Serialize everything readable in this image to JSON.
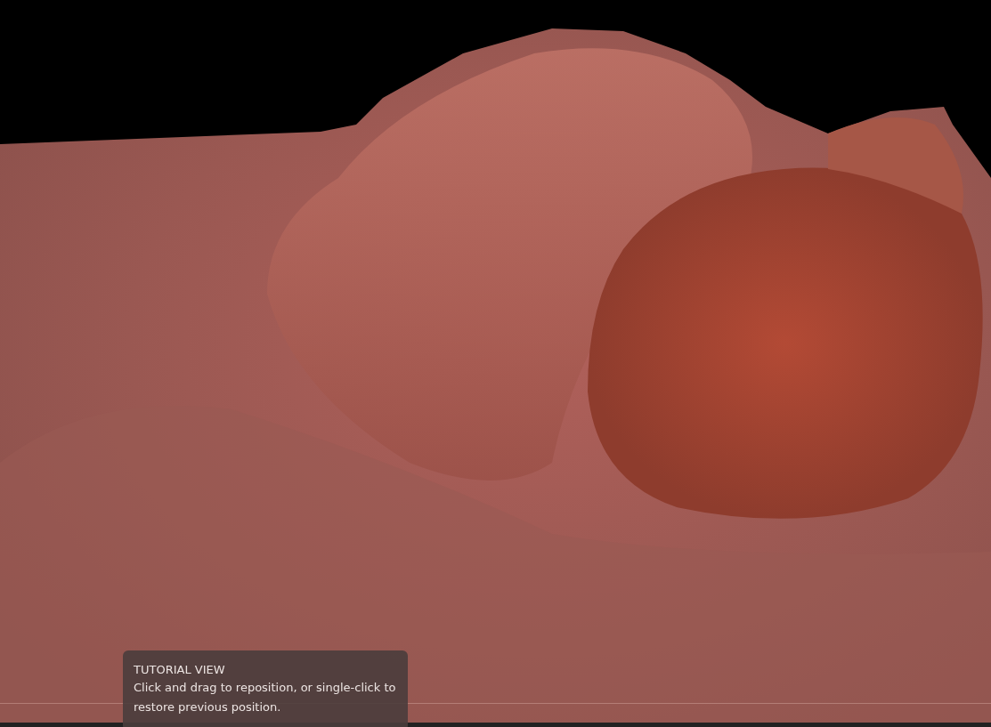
{
  "tooltip": {
    "title": "TUTORIAL VIEW",
    "message": "Click and drag to reposition, or single-click to restore previous position."
  }
}
